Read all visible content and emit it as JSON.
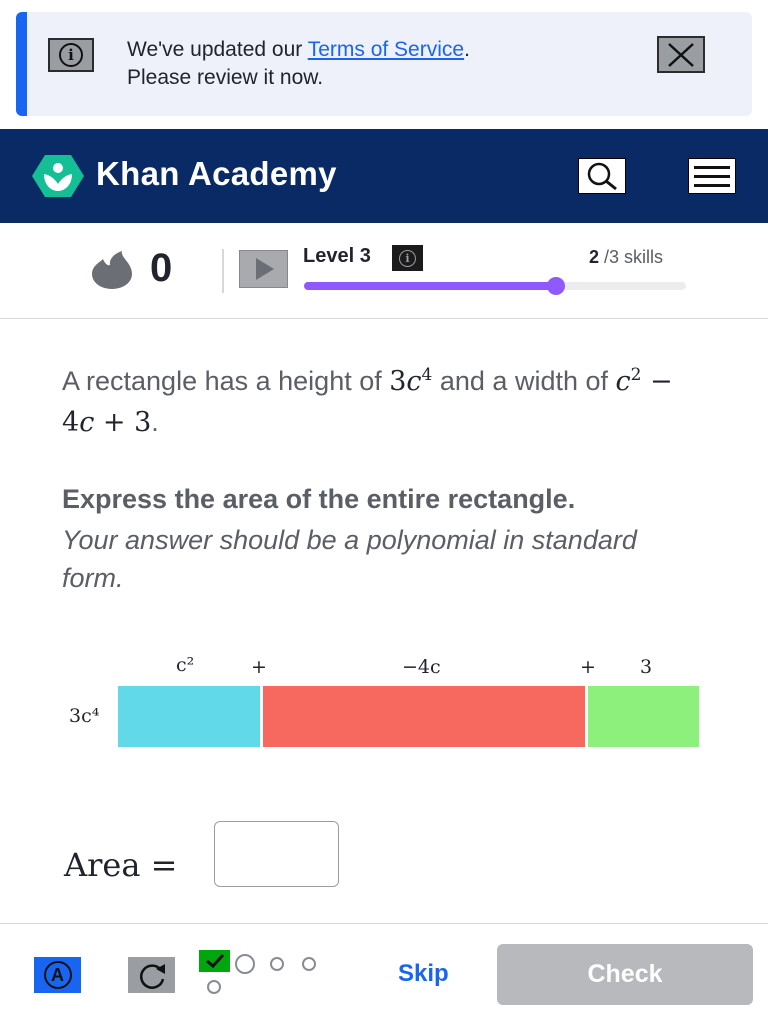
{
  "notice": {
    "line1_prefix": "We've updated our ",
    "link": "Terms of Service",
    "line1_suffix": ".",
    "line2": "Please review it now.",
    "info_icon": "info-icon",
    "close_icon": "close-icon"
  },
  "header": {
    "brand": "Khan Academy",
    "search_icon": "search-icon",
    "menu_icon": "hamburger-menu-icon"
  },
  "progress": {
    "streak_count": "0",
    "level_label": "Level 3",
    "skills_done": "2",
    "skills_total": " /3 skills",
    "level_fraction": 0.66
  },
  "question": {
    "intro_a": "A rectangle has a height of ",
    "intro_b": " and a width of ",
    "intro_c": ".",
    "instruction": "Express the area of the entire rectangle.",
    "hint": "Your answer should be a polynomial in standard form."
  },
  "diagram": {
    "height_label": "3c⁴",
    "width_terms": [
      "c²",
      "+",
      "−4c",
      "+",
      "3"
    ]
  },
  "answer": {
    "label": "Area =",
    "value": ""
  },
  "footer": {
    "skip": "Skip",
    "check": "Check",
    "colors": {
      "accent": "#1865f2",
      "progress": "#9059ff",
      "header": "#0a2a66"
    }
  }
}
